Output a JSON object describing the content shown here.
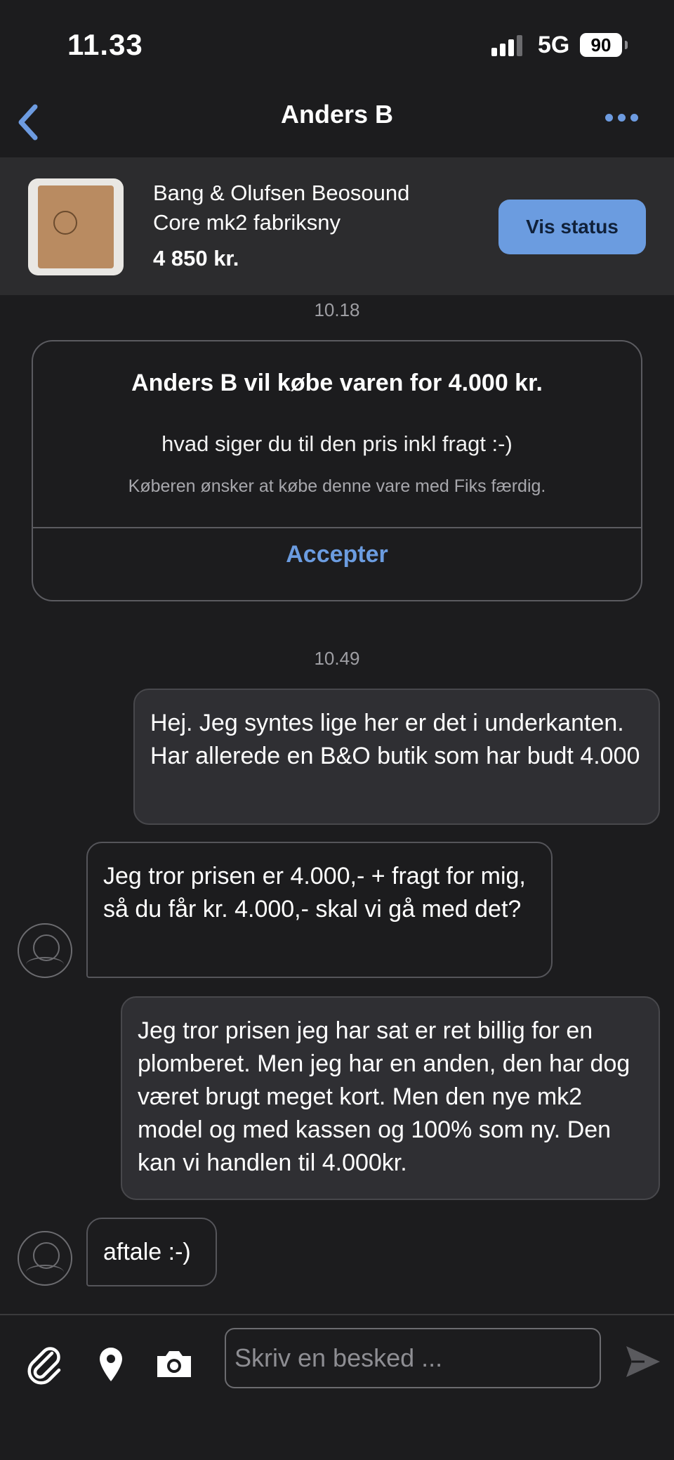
{
  "status_bar": {
    "time": "11.33",
    "network": "5G",
    "battery": "90"
  },
  "nav": {
    "title": "Anders B",
    "back_icon": "chevron-left-icon",
    "more_icon": "more-horizontal-icon",
    "accent_color": "#6d9be0"
  },
  "product": {
    "title": "Bang & Olufsen Beosound Core mk2 fabriksny",
    "price": "4 850 kr.",
    "status_button": "Vis status"
  },
  "chat": {
    "time_1": "10.18",
    "offer": {
      "title": "Anders B vil købe varen for 4.000 kr.",
      "message": "hvad siger du til den pris inkl fragt :-)",
      "note": "Køberen ønsker at købe denne vare med Fiks færdig.",
      "accept_label": "Accepter"
    },
    "time_2": "10.49",
    "messages": [
      {
        "direction": "out",
        "text": "Hej. Jeg syntes lige her er det i underkanten. Har allerede en B&O butik som har budt 4.000"
      },
      {
        "direction": "in",
        "text": "Jeg tror prisen er 4.000,- + fragt for mig, så du får kr. 4.000,- skal vi gå med det?"
      },
      {
        "direction": "out",
        "text": "Jeg tror prisen jeg har sat er ret billig for en plomberet. Men jeg har en anden, den har dog været brugt meget kort. Men den nye mk2 model og med kassen og 100% som ny. Den kan vi handlen til 4.000kr."
      },
      {
        "direction": "in",
        "text": "aftale :-)"
      }
    ]
  },
  "composer": {
    "placeholder": "Skriv en besked ...",
    "icons": [
      "paperclip-icon",
      "location-pin-icon",
      "camera-icon",
      "send-icon"
    ]
  }
}
